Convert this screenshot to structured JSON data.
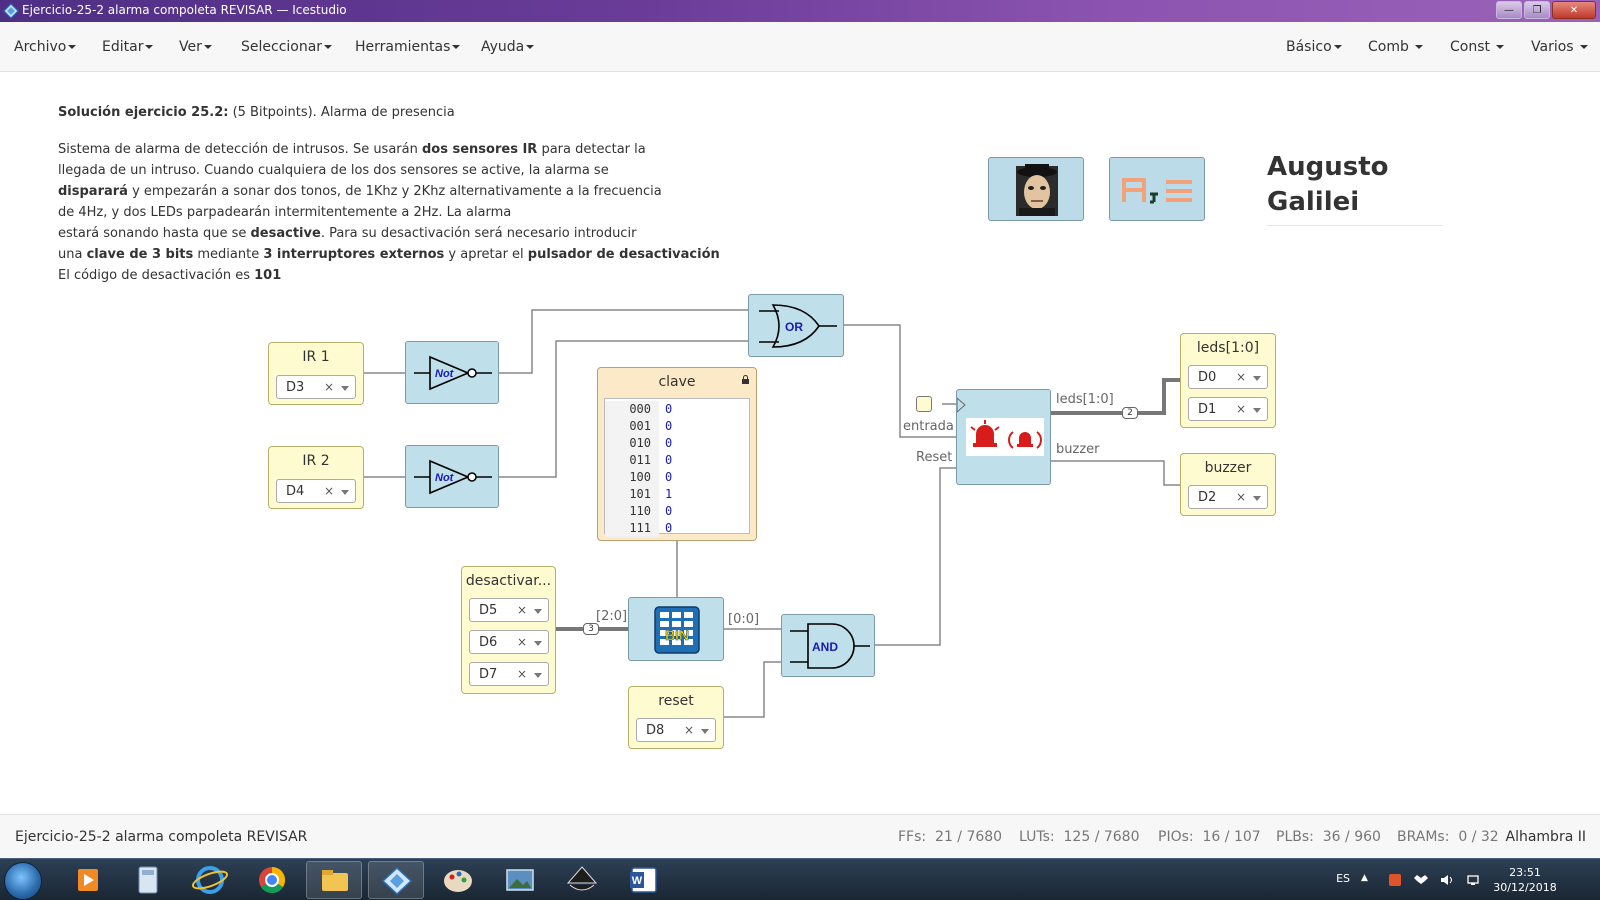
{
  "window": {
    "title": "Ejercicio-25-2 alarma compoleta REVISAR — Icestudio"
  },
  "menu": {
    "left": [
      "Archivo",
      "Editar",
      "Ver",
      "Seleccionar",
      "Herramientas",
      "Ayuda"
    ],
    "right": [
      "Básico",
      "Comb",
      "Const",
      "Varios"
    ]
  },
  "description": {
    "title_bold": "Solución ejercicio 25.2:",
    "title_rest": " (5 Bitpoints). Alarma de presencia",
    "lines": [
      [
        {
          "t": "Sistema de alarma de detección de intrusos. Se usarán "
        },
        {
          "b": "dos sensores IR"
        },
        {
          "t": " para detectar la"
        }
      ],
      [
        {
          "t": "llegada de un intruso. Cuando cualquiera de los dos sensores se active, la alarma se"
        }
      ],
      [
        {
          "b": "disparará"
        },
        {
          "t": " y empezarán a sonar dos tonos, de 1Khz y 2Khz alternativamente a la frecuencia"
        }
      ],
      [
        {
          "t": "de 4Hz, y dos LEDs parpadearán intermitentemente a 2Hz. La alarma"
        }
      ],
      [
        {
          "t": "estará sonando hasta que se "
        },
        {
          "b": "desactive"
        },
        {
          "t": ". Para su desactivación será necesario introducir"
        }
      ],
      [
        {
          "t": "una "
        },
        {
          "b": "clave de 3 bits"
        },
        {
          "t": " mediante "
        },
        {
          "b": "3 interruptores externos"
        },
        {
          "t": " y apretar el "
        },
        {
          "b": "pulsador de desactivación"
        }
      ],
      [
        {
          "t": "El código de desactivación es "
        },
        {
          "b": "101"
        }
      ]
    ]
  },
  "author": {
    "name_line1": "Augusto",
    "name_line2": "Galilei"
  },
  "blocks": {
    "ir1": {
      "label": "IR 1",
      "pin": "D3"
    },
    "ir2": {
      "label": "IR 2",
      "pin": "D4"
    },
    "not1": {
      "label": "Not"
    },
    "not2": {
      "label": "Not"
    },
    "or": {
      "label": "OR"
    },
    "and": {
      "label": "AND"
    },
    "bin": {
      "label": "BIN"
    },
    "clave": {
      "label": "clave",
      "rows": [
        {
          "addr": "000",
          "val": "0"
        },
        {
          "addr": "001",
          "val": "0"
        },
        {
          "addr": "010",
          "val": "0"
        },
        {
          "addr": "011",
          "val": "0"
        },
        {
          "addr": "100",
          "val": "0"
        },
        {
          "addr": "101",
          "val": "1"
        },
        {
          "addr": "110",
          "val": "0"
        },
        {
          "addr": "111",
          "val": "0"
        }
      ]
    },
    "desactivar": {
      "label": "desactivar...",
      "pins": [
        "D5",
        "D6",
        "D7"
      ]
    },
    "reset": {
      "label": "reset",
      "pin": "D8"
    },
    "leds": {
      "label": "leds[1:0]",
      "pins": [
        "D0",
        "D1"
      ]
    },
    "buzzer": {
      "label": "buzzer",
      "pin": "D2"
    }
  },
  "wire_labels": {
    "entrada": "entrada",
    "reset": "Reset",
    "leds": "leds[1:0]",
    "buzzer": "buzzer",
    "bus_in": "[2:0]",
    "bus_out": "[0:0]",
    "bus_width_3": "3",
    "bus_width_2": "2"
  },
  "status": {
    "project": "Ejercicio-25-2 alarma compoleta REVISAR",
    "stats": [
      {
        "name": "FFs:",
        "value": "21 / 7680"
      },
      {
        "name": "LUTs:",
        "value": "125 / 7680"
      },
      {
        "name": "PIOs:",
        "value": "16 / 107"
      },
      {
        "name": "PLBs:",
        "value": "36 / 960"
      },
      {
        "name": "BRAMs:",
        "value": "0 / 32"
      }
    ],
    "board": "Alhambra II"
  },
  "taskbar": {
    "lang": "ES",
    "time": "23:51",
    "date": "30/12/2018"
  },
  "colors": {
    "block_blue": "#bfe0ea",
    "io_yellow": "#fffbd0",
    "memory_orange": "#fbe9c8",
    "gate_label_blue": "#1a1ab0",
    "alarm_red": "#d81c1c"
  }
}
